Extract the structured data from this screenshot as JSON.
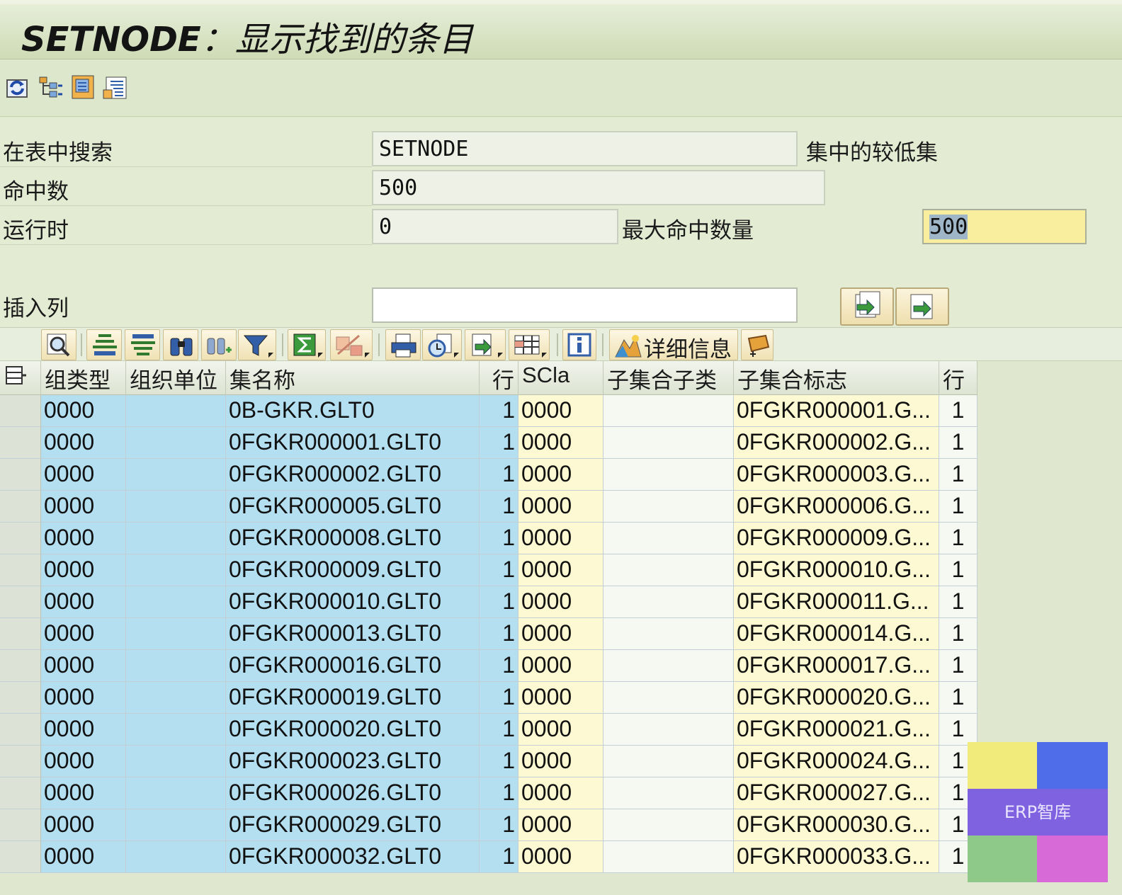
{
  "title": {
    "code": "SETNODE",
    "sep": "：",
    "text": "显示找到的条目"
  },
  "app_toolbar": {
    "icons": [
      "refresh-icon",
      "hierarchy-icon",
      "table-settings-icon",
      "document-list-icon"
    ]
  },
  "form": {
    "search_table": {
      "label": "在表中搜索",
      "value": "SETNODE",
      "side_label": "集中的较低集"
    },
    "hits": {
      "label": "命中数",
      "value": "500"
    },
    "runtime": {
      "label": "运行时",
      "value": "0",
      "max_label": "最大命中数量",
      "max_value": "500"
    },
    "insert_column": {
      "label": "插入列",
      "value": ""
    }
  },
  "alv_toolbar": {
    "details_label": "详细信息"
  },
  "grid": {
    "columns": [
      "组类型",
      "组织单位",
      "集名称",
      "行",
      "SCla",
      "子集合子类",
      "子集合标志",
      "行"
    ],
    "rows": [
      [
        "0000",
        "",
        "0B-GKR.GLT0",
        "1",
        "0000",
        "",
        "0FGKR000001.G...",
        "1"
      ],
      [
        "0000",
        "",
        "0FGKR000001.GLT0",
        "1",
        "0000",
        "",
        "0FGKR000002.G...",
        "1"
      ],
      [
        "0000",
        "",
        "0FGKR000002.GLT0",
        "1",
        "0000",
        "",
        "0FGKR000003.G...",
        "1"
      ],
      [
        "0000",
        "",
        "0FGKR000005.GLT0",
        "1",
        "0000",
        "",
        "0FGKR000006.G...",
        "1"
      ],
      [
        "0000",
        "",
        "0FGKR000008.GLT0",
        "1",
        "0000",
        "",
        "0FGKR000009.G...",
        "1"
      ],
      [
        "0000",
        "",
        "0FGKR000009.GLT0",
        "1",
        "0000",
        "",
        "0FGKR000010.G...",
        "1"
      ],
      [
        "0000",
        "",
        "0FGKR000010.GLT0",
        "1",
        "0000",
        "",
        "0FGKR000011.G...",
        "1"
      ],
      [
        "0000",
        "",
        "0FGKR000013.GLT0",
        "1",
        "0000",
        "",
        "0FGKR000014.G...",
        "1"
      ],
      [
        "0000",
        "",
        "0FGKR000016.GLT0",
        "1",
        "0000",
        "",
        "0FGKR000017.G...",
        "1"
      ],
      [
        "0000",
        "",
        "0FGKR000019.GLT0",
        "1",
        "0000",
        "",
        "0FGKR000020.G...",
        "1"
      ],
      [
        "0000",
        "",
        "0FGKR000020.GLT0",
        "1",
        "0000",
        "",
        "0FGKR000021.G...",
        "1"
      ],
      [
        "0000",
        "",
        "0FGKR000023.GLT0",
        "1",
        "0000",
        "",
        "0FGKR000024.G...",
        "1"
      ],
      [
        "0000",
        "",
        "0FGKR000026.GLT0",
        "1",
        "0000",
        "",
        "0FGKR000027.G...",
        "1"
      ],
      [
        "0000",
        "",
        "0FGKR000029.GLT0",
        "1",
        "0000",
        "",
        "0FGKR000030.G...",
        "1"
      ],
      [
        "0000",
        "",
        "0FGKR000032.GLT0",
        "1",
        "0000",
        "",
        "0FGKR000033.G...",
        "1"
      ]
    ]
  },
  "watermark": {
    "text": "ERP智库",
    "colors": [
      "#f0eb7a",
      "#4f6de8",
      "#7f62e0",
      "#8ec98a",
      "#d86ad8"
    ]
  },
  "colors": {
    "key_column": "#b3dff0",
    "yellow_column": "#fdf9d2",
    "highlight_field": "#f8ee9e"
  }
}
